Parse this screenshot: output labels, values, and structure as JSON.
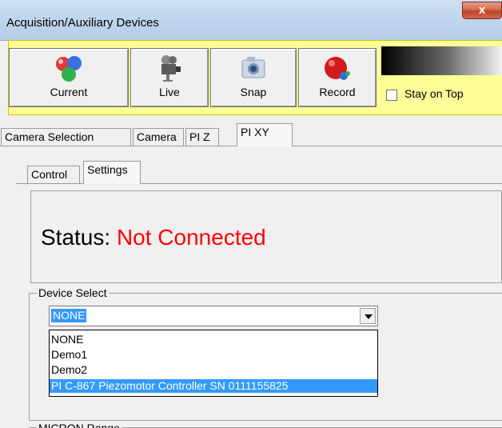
{
  "window": {
    "title": "Acquisition/Auxiliary Devices",
    "close_label": "x"
  },
  "toolbar": {
    "buttons": [
      {
        "label": "Current",
        "icon": "colored-balls-icon"
      },
      {
        "label": "Live",
        "icon": "video-camera-icon"
      },
      {
        "label": "Snap",
        "icon": "camera-icon"
      },
      {
        "label": "Record",
        "icon": "record-icon"
      }
    ],
    "stay_on_top_label": "Stay on Top",
    "stay_on_top_checked": false
  },
  "main_tabs": [
    {
      "label": "Camera Selection",
      "active": false
    },
    {
      "label": "Camera",
      "active": false
    },
    {
      "label": "PI Z",
      "active": false
    },
    {
      "label": "PI XY",
      "active": true
    }
  ],
  "sub_tabs": [
    {
      "label": "Control",
      "active": false
    },
    {
      "label": "Settings",
      "active": true
    }
  ],
  "status": {
    "label": "Status:",
    "value": "Not Connected",
    "value_color": "#ff0000"
  },
  "device_select": {
    "title": "Device Select",
    "selected": "NONE",
    "options": [
      "NONE",
      "Demo1",
      "Demo2",
      "PI C-867 Piezomotor Controller SN 0111155825"
    ],
    "highlighted": "PI C-867 Piezomotor Controller SN 0111155825"
  },
  "micron_range": {
    "title": "MICRON Range"
  },
  "colors": {
    "toolbar_bg": "#ffff99",
    "selection": "#3399ff"
  }
}
